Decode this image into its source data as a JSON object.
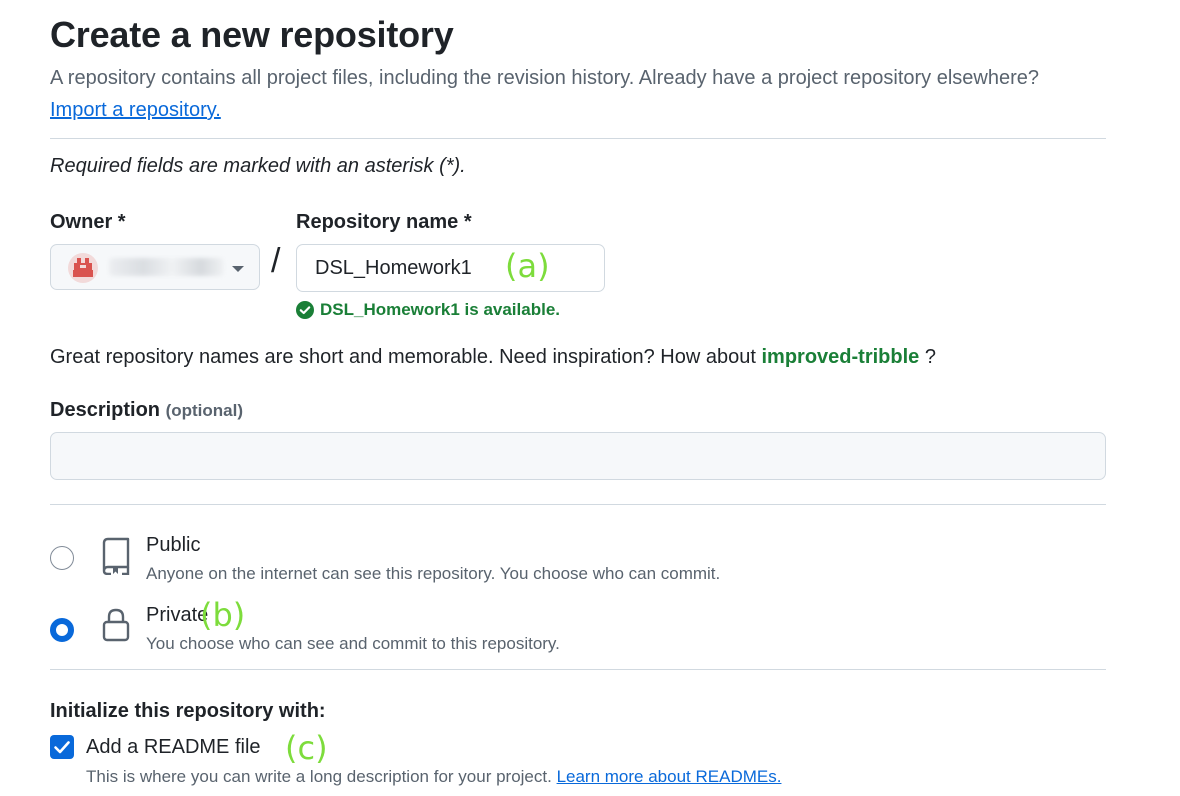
{
  "header": {
    "title": "Create a new repository",
    "subtitle": "A repository contains all project files, including the revision history. Already have a project repository elsewhere?",
    "import_link": "Import a repository."
  },
  "required_note": "Required fields are marked with an asterisk (*).",
  "owner": {
    "label": "Owner *",
    "avatar_color": "#d9534f"
  },
  "separator": "/",
  "repository": {
    "label": "Repository name *",
    "value": "DSL_Homework1",
    "availability": "DSL_Homework1 is available.",
    "available_color": "#1a7f37"
  },
  "hint": {
    "text": "Great repository names are short and memorable. Need inspiration? How about",
    "suggestion": "improved-tribble",
    "suffix": "?"
  },
  "description": {
    "label": "Description",
    "optional": "(optional)",
    "value": ""
  },
  "visibility": {
    "options": [
      {
        "title": "Public",
        "description": "Anyone on the internet can see this repository. You choose who can commit.",
        "icon": "repo-book-icon",
        "selected": false
      },
      {
        "title": "Private",
        "description": "You choose who can see and commit to this repository.",
        "icon": "lock-icon",
        "selected": true
      }
    ]
  },
  "initialize": {
    "label": "Initialize this repository with:",
    "readme_label": "Add a README file",
    "readme_checked": true,
    "readme_description": "This is where you can write a long description for your project.",
    "readme_link": "Learn more about READMEs."
  },
  "annotations": {
    "a": "(a)",
    "b": "(b)",
    "c": "(c)",
    "color": "#7ddc3c"
  },
  "colors": {
    "accent": "#0969da",
    "text": "#1f2328",
    "muted": "#59636e",
    "border": "#d1d9e0"
  }
}
